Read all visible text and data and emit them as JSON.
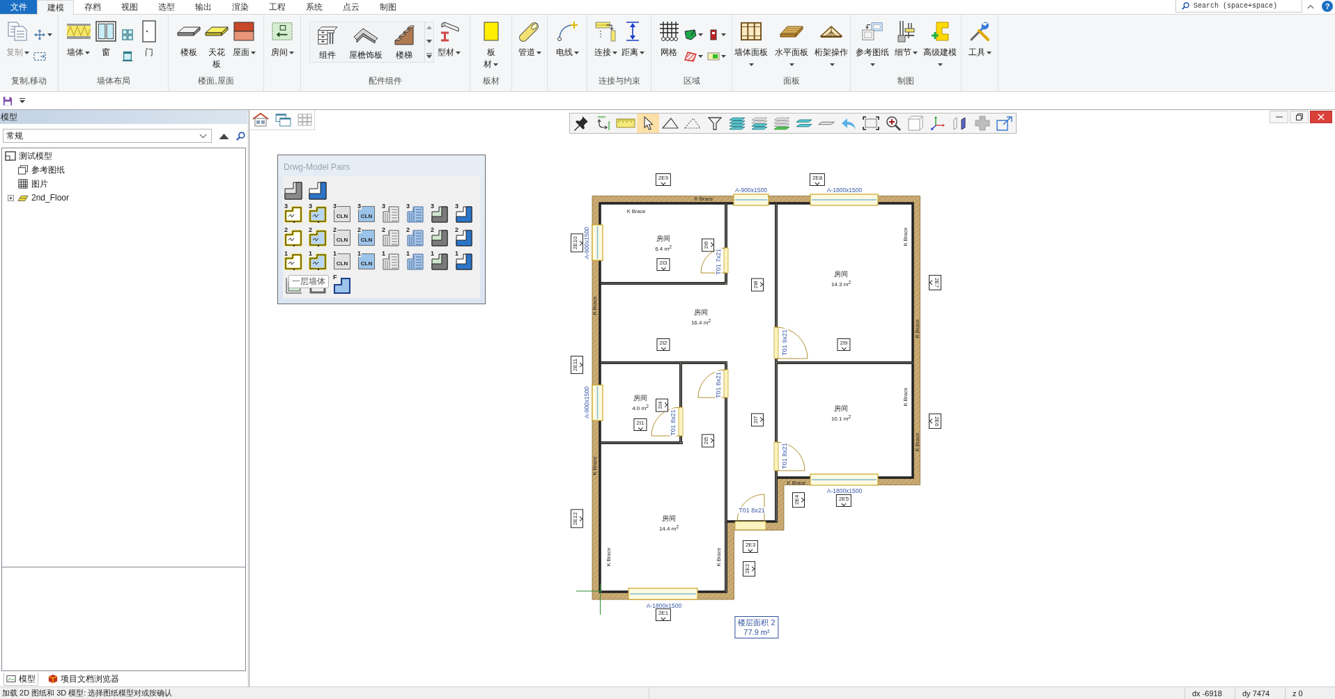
{
  "ribbon": {
    "tabs": [
      {
        "label": "文件",
        "kind": "file",
        "selected": false
      },
      {
        "label": "建模",
        "kind": "tab",
        "selected": true
      },
      {
        "label": "存档",
        "kind": "tab",
        "selected": false
      },
      {
        "label": "视图",
        "kind": "tab",
        "selected": false
      },
      {
        "label": "选型",
        "kind": "tab",
        "selected": false
      },
      {
        "label": "输出",
        "kind": "tab",
        "selected": false
      },
      {
        "label": "渲染",
        "kind": "tab",
        "selected": false
      },
      {
        "label": "工程",
        "kind": "tab",
        "selected": false
      },
      {
        "label": "系统",
        "kind": "tab",
        "selected": false
      },
      {
        "label": "点云",
        "kind": "tab",
        "selected": false
      },
      {
        "label": "制图",
        "kind": "tab",
        "selected": false
      }
    ],
    "search": {
      "placeholder": "Search (space+space)"
    },
    "help": "?",
    "groups": [
      {
        "label": "复制,移动",
        "items": [
          {
            "kind": "large",
            "label": "复制",
            "dropdown": true,
            "disabled": true
          },
          {
            "kind": "stack",
            "buttons": [
              {
                "dropdown": true,
                "disabled": false
              },
              {
                "dropdown": false,
                "disabled": false
              }
            ]
          }
        ]
      },
      {
        "label": "墙体布局",
        "items": [
          {
            "kind": "large",
            "label": "墙体",
            "dropdown": true,
            "disabled": false
          },
          {
            "kind": "large",
            "label": "窗",
            "dropdown": false,
            "disabled": false
          },
          {
            "kind": "stack",
            "buttons": [
              {
                "dropdown": false,
                "disabled": false
              },
              {
                "dropdown": false,
                "disabled": false
              }
            ]
          },
          {
            "kind": "large",
            "label": "门",
            "dropdown": false,
            "disabled": false
          }
        ]
      },
      {
        "label": "楼面,屋面",
        "items": [
          {
            "kind": "large",
            "label": "楼板",
            "dropdown": false,
            "disabled": false
          },
          {
            "kind": "large",
            "label": "天花板",
            "dropdown": false,
            "disabled": false
          },
          {
            "kind": "large",
            "label": "屋面",
            "dropdown": true,
            "disabled": false
          }
        ]
      },
      {
        "items": [
          {
            "kind": "large",
            "label": "房间",
            "dropdown": true,
            "disabled": false
          }
        ]
      },
      {
        "label": "配件组件",
        "items": [
          {
            "kind": "gallery",
            "entries": [
              "组件",
              "屋檐饰板",
              "楼梯"
            ]
          },
          {
            "kind": "large",
            "label": "型材",
            "dropdown": true,
            "disabled": false
          }
        ]
      },
      {
        "label": "板材",
        "items": [
          {
            "kind": "large",
            "label": "板材",
            "dropdown": true,
            "disabled": false
          }
        ]
      },
      {
        "items": [
          {
            "kind": "large",
            "label": "管道",
            "dropdown": true,
            "disabled": false
          }
        ]
      },
      {
        "items": [
          {
            "kind": "large",
            "label": "电线",
            "dropdown": true,
            "disabled": false
          }
        ]
      },
      {
        "label": "连接与约束",
        "items": [
          {
            "kind": "large",
            "label": "连接",
            "dropdown": true,
            "disabled": false
          },
          {
            "kind": "large",
            "label": "距离",
            "dropdown": true,
            "disabled": false
          }
        ]
      },
      {
        "label": "区域",
        "items": [
          {
            "kind": "large",
            "label": "网格",
            "dropdown": false,
            "disabled": false
          },
          {
            "kind": "stack",
            "buttons": [
              {
                "dropdown": true,
                "disabled": false
              },
              {
                "dropdown": true,
                "disabled": false
              }
            ]
          },
          {
            "kind": "stack",
            "buttons": [
              {
                "dropdown": true,
                "disabled": false
              },
              {
                "dropdown": true,
                "disabled": false
              }
            ]
          }
        ]
      },
      {
        "label": "面板",
        "items": [
          {
            "kind": "large",
            "label": "墙体面板",
            "dropdown": true,
            "disabled": false
          },
          {
            "kind": "large",
            "label": "水平面板",
            "dropdown": true,
            "disabled": false
          },
          {
            "kind": "large",
            "label": "桁架操作",
            "dropdown": true,
            "disabled": false
          }
        ]
      },
      {
        "label": "制图",
        "items": [
          {
            "kind": "large",
            "label": "参考图纸",
            "dropdown": true,
            "disabled": false
          },
          {
            "kind": "large",
            "label": "细节",
            "dropdown": true,
            "disabled": false
          },
          {
            "kind": "large",
            "label": "高级建模",
            "dropdown": true,
            "disabled": false
          }
        ]
      },
      {
        "items": [
          {
            "kind": "large",
            "label": "工具",
            "dropdown": true,
            "disabled": false
          }
        ]
      }
    ]
  },
  "model_tree": {
    "header": "模型",
    "filter": {
      "value": "常规"
    },
    "nodes": [
      {
        "label": "测试模型",
        "kind": "model",
        "children": [
          {
            "label": "参考图纸",
            "kind": "drawings"
          },
          {
            "label": "图片",
            "kind": "images"
          },
          {
            "label": "2nd_Floor",
            "kind": "floor",
            "expanded": false
          }
        ]
      }
    ]
  },
  "bottom_tabs": [
    {
      "label": "模型",
      "selected": true
    },
    {
      "label": "项目文档浏览器",
      "selected": false
    }
  ],
  "canvas_toolbar": [
    {
      "selected": false
    },
    {
      "selected": false
    },
    {
      "selected": false
    },
    {
      "selected": true
    },
    {
      "selected": false
    },
    {
      "selected": false
    },
    {
      "selected": false
    },
    {
      "selected": false
    },
    {
      "selected": false
    },
    {
      "selected": false
    },
    {
      "selected": false
    },
    {
      "selected": false
    },
    {
      "selected": false
    },
    {
      "selected": false
    },
    {
      "selected": false
    },
    {
      "selected": false
    },
    {
      "selected": false
    },
    {
      "selected": false
    },
    {
      "selected": false
    },
    {
      "selected": false
    }
  ],
  "drwg_model_pairs": {
    "title": "Drwg-Model Pairs",
    "rows": [
      [
        {
          "kind": "corner"
        },
        {
          "kind": "cornerfill"
        }
      ],
      [
        {
          "kind": "outline",
          "digit": "3"
        },
        {
          "kind": "outlinefill",
          "digit": "3"
        },
        {
          "kind": "clean",
          "digit": "3",
          "text": "CLN"
        },
        {
          "kind": "cleanfill",
          "digit": "3",
          "text": "CLN"
        },
        {
          "kind": "stack",
          "digit": "3"
        },
        {
          "kind": "stackfill",
          "digit": "3"
        },
        {
          "kind": "ledge",
          "digit": "3"
        },
        {
          "kind": "ledgefill",
          "digit": "3"
        }
      ],
      [
        {
          "kind": "outline",
          "digit": "2"
        },
        {
          "kind": "outlinefill",
          "digit": "2"
        },
        {
          "kind": "clean",
          "digit": "2",
          "text": "CLN"
        },
        {
          "kind": "cleanfill",
          "digit": "2",
          "text": "CLN"
        },
        {
          "kind": "stack",
          "digit": "2"
        },
        {
          "kind": "stackfill",
          "digit": "2"
        },
        {
          "kind": "ledge",
          "digit": "2"
        },
        {
          "kind": "ledgefill",
          "digit": "2"
        }
      ],
      [
        {
          "kind": "outline",
          "digit": "1"
        },
        {
          "kind": "outlinefill",
          "digit": "1"
        },
        {
          "kind": "clean",
          "digit": "1",
          "text": "CLN"
        },
        {
          "kind": "cleanfill",
          "digit": "1",
          "text": "CLN"
        },
        {
          "kind": "stack",
          "digit": "1"
        },
        {
          "kind": "stackfill",
          "digit": "1"
        },
        {
          "kind": "ledge",
          "digit": "1"
        },
        {
          "kind": "ledgefill",
          "digit": "1"
        }
      ],
      [
        {
          "kind": "axis"
        },
        {
          "kind": "frame"
        },
        {
          "kind": "floor",
          "digit": "F"
        }
      ]
    ],
    "tooltip": "一层墙体"
  },
  "floor_plan": {
    "tags": [
      "2E9",
      "2E8",
      "2E10",
      "2I6",
      "2I3",
      "2I8",
      "2E7",
      "2I2",
      "2I9",
      "2E11",
      "2I4",
      "2I1",
      "2I7",
      "2E6",
      "2I5",
      "2E4",
      "2E5",
      "2E12",
      "2E3",
      "2E2",
      "2E1"
    ],
    "windows": [
      "A-900x1500",
      "A-1800x1500",
      "A-900x1500",
      "A-900x1500",
      "A-1800x1500",
      "A-1800x1500"
    ],
    "braces": [
      "K Brace",
      "K Brace",
      "K Brace",
      "K Brace",
      "K Brace",
      "K Brace",
      "K Brace",
      "K Brace",
      "K Brace",
      "K Brace",
      "K Brace"
    ],
    "rooms": [
      {
        "name": "房间",
        "area": "6.4 m$^{2}$"
      },
      {
        "name": "房间",
        "area": "14.3 m$^{2}$"
      },
      {
        "name": "房间",
        "area": "16.4 m$^{2}$"
      },
      {
        "name": "房间",
        "area": "4.0 m$^{2}$"
      },
      {
        "name": "房间",
        "area": "10.1 m$^{2}$"
      },
      {
        "name": "房间",
        "area": "14.4 m$^{2}$"
      }
    ],
    "doors": [
      "T01 7x21",
      "T01 9x21",
      "T01 8x21",
      "T01 8x21",
      "T01 8x21",
      "T01 8x21"
    ],
    "floor_area": {
      "title": "楼层面积 2",
      "value": "77.9 m²"
    }
  },
  "status_bar": {
    "message": "加载 2D 图纸和 3D 模型: 选择图纸模型对或按确认",
    "fields": [
      "dx -6918",
      "dy 7474",
      "z 0"
    ]
  }
}
